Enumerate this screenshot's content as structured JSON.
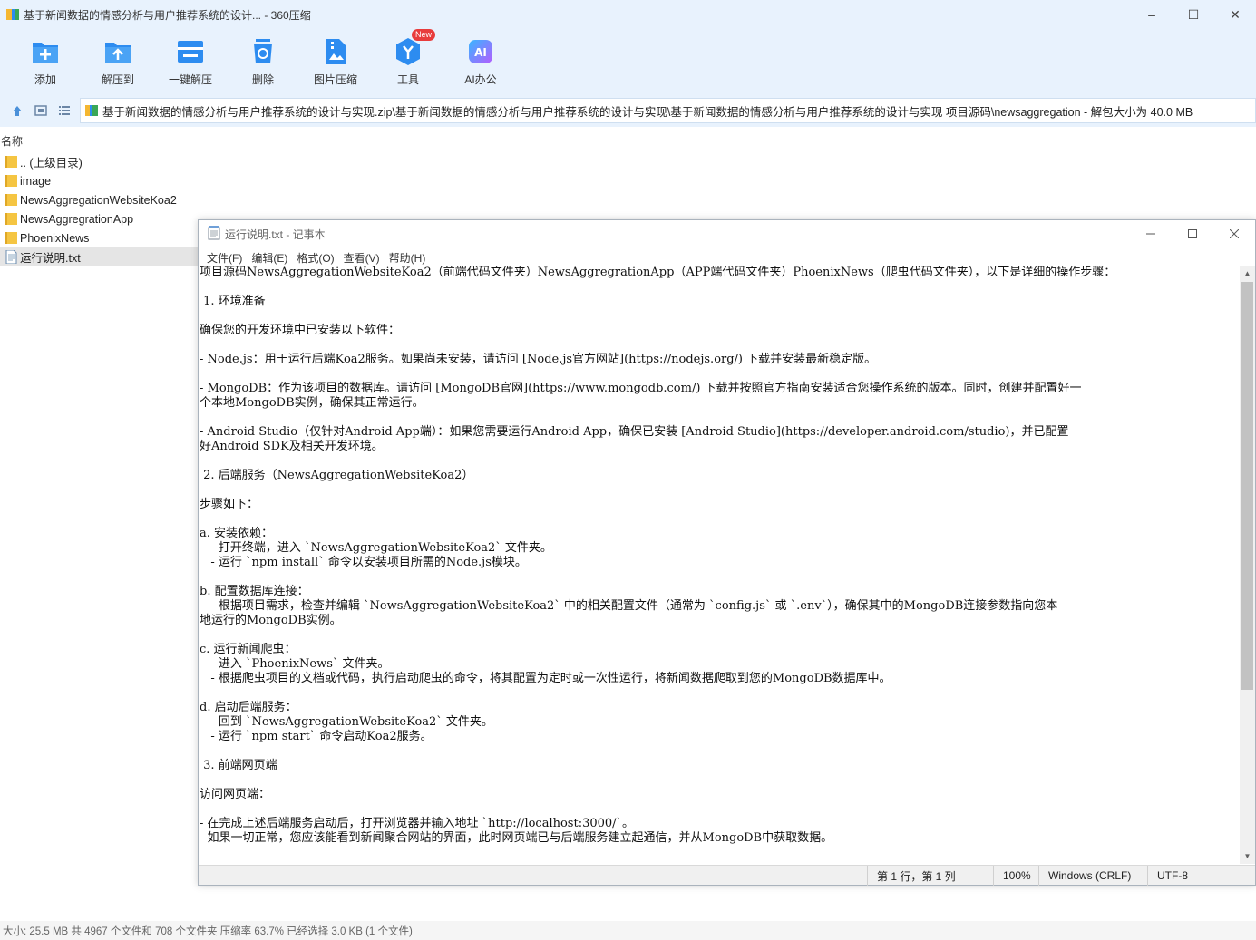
{
  "window": {
    "title": "基于新闻数据的情感分析与用户推荐系统的设计... - 360压缩"
  },
  "toolbar": {
    "items": [
      {
        "label": "添加",
        "icon": "add-icon"
      },
      {
        "label": "解压到",
        "icon": "extract-to-icon"
      },
      {
        "label": "一键解压",
        "icon": "one-click-extract-icon"
      },
      {
        "label": "删除",
        "icon": "delete-icon"
      },
      {
        "label": "图片压缩",
        "icon": "image-compress-icon"
      },
      {
        "label": "工具",
        "icon": "tools-icon",
        "badge": "New"
      },
      {
        "label": "AI办公",
        "icon": "ai-office-icon"
      }
    ]
  },
  "address": {
    "path": "基于新闻数据的情感分析与用户推荐系统的设计与实现.zip\\基于新闻数据的情感分析与用户推荐系统的设计与实现\\基于新闻数据的情感分析与用户推荐系统的设计与实现 项目源码\\newsaggregation - 解包大小为 40.0 MB"
  },
  "file_list": {
    "header": "名称",
    "items": [
      {
        "name": ".. (上级目录)",
        "type": "folder"
      },
      {
        "name": "image",
        "type": "folder"
      },
      {
        "name": "NewsAggregationWebsiteKoa2",
        "type": "folder"
      },
      {
        "name": "NewsAggregrationApp",
        "type": "folder"
      },
      {
        "name": "PhoenixNews",
        "type": "folder"
      },
      {
        "name": "运行说明.txt",
        "type": "file",
        "selected": true
      }
    ]
  },
  "zip_status": "大小: 25.5 MB 共 4967 个文件和 708 个文件夹 压缩率 63.7% 已经选择 3.0 KB (1 个文件)",
  "notepad": {
    "title": "运行说明.txt - 记事本",
    "menus": [
      "文件(F)",
      "编辑(E)",
      "格式(O)",
      "查看(V)",
      "帮助(H)"
    ],
    "lines": [
      "项目源码NewsAggregationWebsiteKoa2（前端代码文件夹）NewsAggregrationApp（APP端代码文件夹）PhoenixNews（爬虫代码文件夹），以下是详细的操作步骤：",
      "",
      " 1. 环境准备",
      "",
      "确保您的开发环境中已安装以下软件：",
      "",
      "- Node.js：用于运行后端Koa2服务。如果尚未安装，请访问 [Node.js官方网站](https://nodejs.org/) 下载并安装最新稳定版。",
      "",
      "- MongoDB：作为该项目的数据库。请访问 [MongoDB官网](https://www.mongodb.com/) 下载并按照官方指南安装适合您操作系统的版本。同时，创建并配置好一",
      "个本地MongoDB实例，确保其正常运行。",
      "",
      "- Android Studio（仅针对Android App端）：如果您需要运行Android App，确保已安装 [Android Studio](https://developer.android.com/studio)，并已配置",
      "好Android SDK及相关开发环境。",
      "",
      " 2. 后端服务（NewsAggregationWebsiteKoa2）",
      "",
      "步骤如下：",
      "",
      "a. 安装依赖：",
      "   - 打开终端，进入 `NewsAggregationWebsiteKoa2` 文件夹。",
      "   - 运行 `npm install` 命令以安装项目所需的Node.js模块。",
      "",
      "b. 配置数据库连接：",
      "   - 根据项目需求，检查并编辑 `NewsAggregationWebsiteKoa2` 中的相关配置文件（通常为 `config.js` 或 `.env`），确保其中的MongoDB连接参数指向您本",
      "地运行的MongoDB实例。",
      "",
      "c. 运行新闻爬虫：",
      "   - 进入 `PhoenixNews` 文件夹。",
      "   - 根据爬虫项目的文档或代码，执行启动爬虫的命令，将其配置为定时或一次性运行，将新闻数据爬取到您的MongoDB数据库中。",
      "",
      "d. 启动后端服务：",
      "   - 回到 `NewsAggregationWebsiteKoa2` 文件夹。",
      "   - 运行 `npm start` 命令启动Koa2服务。",
      "",
      " 3. 前端网页端",
      "",
      "访问网页端：",
      "",
      "- 在完成上述后端服务启动后，打开浏览器并输入地址 `http://localhost:3000/`。",
      "- 如果一切正常，您应该能看到新闻聚合网站的界面，此时网页端已与后端服务建立起通信，并从MongoDB中获取数据。"
    ],
    "status": {
      "position": "第 1 行，第 1 列",
      "zoom": "100%",
      "line_ending": "Windows (CRLF)",
      "encoding": "UTF-8"
    }
  },
  "colors": {
    "header_bg": "#e8f2fd",
    "folder": "#f5c542",
    "accent_blue": "#2d8cf0",
    "new_badge": "#e83c3c"
  }
}
